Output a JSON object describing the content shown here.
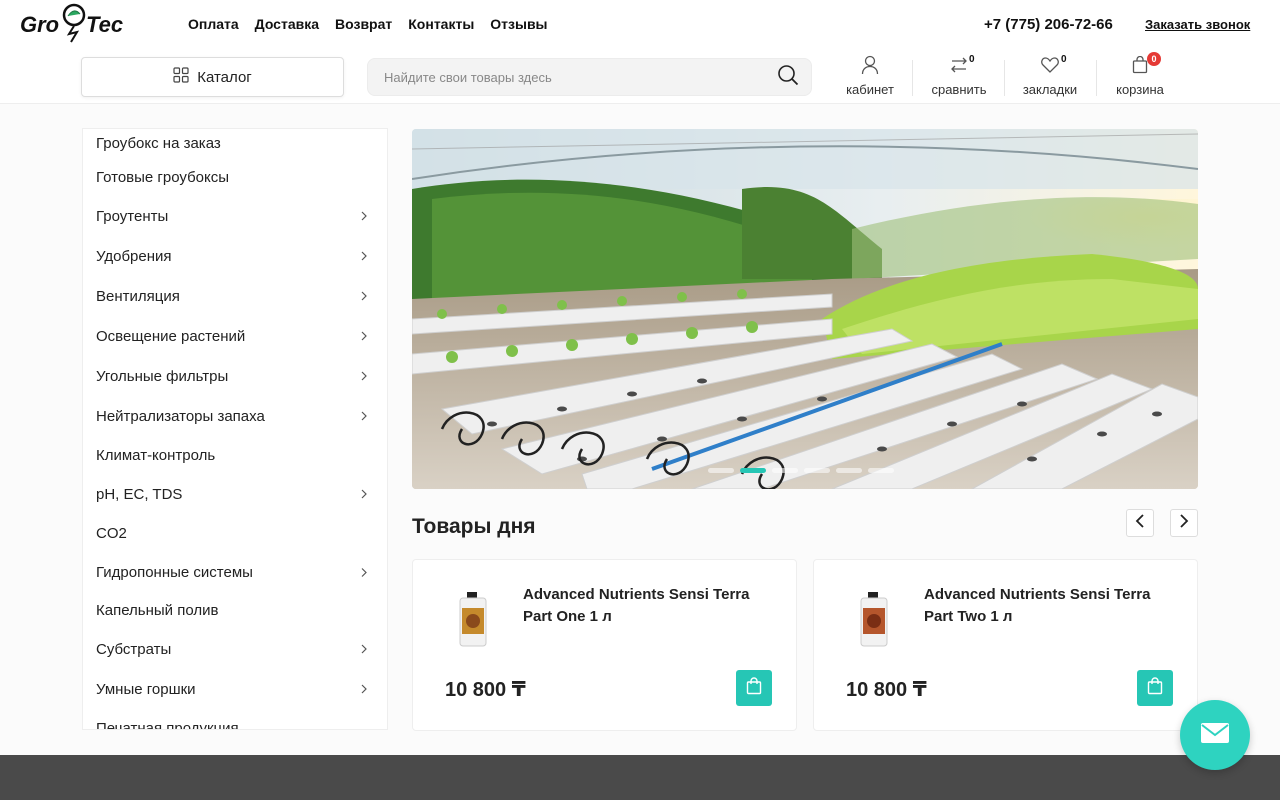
{
  "brand": {
    "logo_text_left": "Gro",
    "logo_text_right": "Tec"
  },
  "topnav": [
    "Оплата",
    "Доставка",
    "Возврат",
    "Контакты",
    "Отзывы"
  ],
  "phone": "+7 (775) 206-72-66",
  "callback": "Заказать звонок",
  "catalog_button": "Каталог",
  "search": {
    "placeholder": "Найдите свои товары здесь"
  },
  "header_icons": {
    "cabinet": {
      "label": "кабинет",
      "icon": "user-icon"
    },
    "compare": {
      "label": "сравнить",
      "count": "0",
      "icon": "compare-icon"
    },
    "bookmarks": {
      "label": "закладки",
      "count": "0",
      "icon": "heart-icon"
    },
    "cart": {
      "label": "корзина",
      "count": "0",
      "icon": "cart-icon"
    }
  },
  "sidebar": {
    "items": [
      {
        "label": "Гроубокс на заказ",
        "has_children": false
      },
      {
        "label": "Готовые гроубоксы",
        "has_children": false
      },
      {
        "label": "Гроутенты",
        "has_children": true
      },
      {
        "label": "Удобрения",
        "has_children": true
      },
      {
        "label": "Вентиляция",
        "has_children": true
      },
      {
        "label": "Освещение растений",
        "has_children": true
      },
      {
        "label": "Угольные фильтры",
        "has_children": true
      },
      {
        "label": "Нейтрализаторы запаха",
        "has_children": true
      },
      {
        "label": "Климат-контроль",
        "has_children": false
      },
      {
        "label": "pH, EC, TDS",
        "has_children": true
      },
      {
        "label": "CO2",
        "has_children": false
      },
      {
        "label": "Гидропонные системы",
        "has_children": true
      },
      {
        "label": "Капельный полив",
        "has_children": false
      },
      {
        "label": "Субстраты",
        "has_children": true
      },
      {
        "label": "Умные горшки",
        "has_children": true
      },
      {
        "label": "Печатная продукция",
        "has_children": false
      }
    ]
  },
  "hero": {
    "slides_count": 6,
    "active_slide": 1
  },
  "products_section": {
    "title": "Товары дня",
    "items": [
      {
        "name": "Advanced Nutrients Sensi Terra Part One 1 л",
        "price": "10 800 ₸"
      },
      {
        "name": "Advanced Nutrients Sensi Terra Part Two 1 л",
        "price": "10 800 ₸"
      }
    ]
  },
  "colors": {
    "accent": "#26c6b5",
    "badge": "#e53935",
    "footer": "#4a4a4a"
  }
}
